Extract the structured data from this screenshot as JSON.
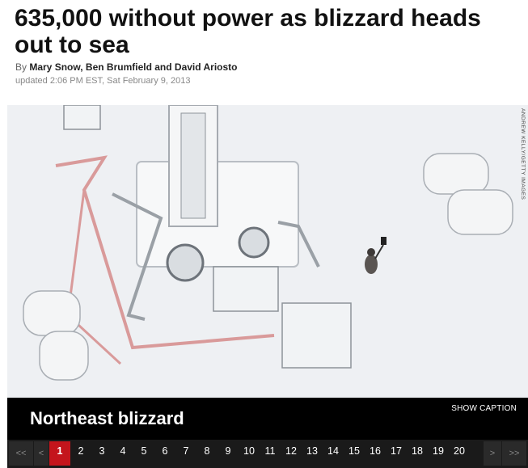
{
  "article": {
    "headline": "635,000 without power as blizzard heads out to sea",
    "byline_prefix": "By ",
    "authors": "Mary Snow, Ben Brumfield and David Ariosto",
    "updated": "updated 2:06 PM EST, Sat February 9, 2013"
  },
  "gallery": {
    "photo_credit": "ANDREW KELLY/GETTY IMAGES",
    "title": "Northeast blizzard",
    "show_caption_label": "SHOW CAPTION",
    "pager": {
      "first": "<<",
      "prev": "<",
      "next": ">",
      "last": ">>",
      "pages": [
        "1",
        "2",
        "3",
        "4",
        "5",
        "6",
        "7",
        "8",
        "9",
        "10",
        "11",
        "12",
        "13",
        "14",
        "15",
        "16",
        "17",
        "18",
        "19",
        "20"
      ],
      "active_page": "1"
    },
    "colors": {
      "active_page": "#c4151c",
      "bar": "#000000"
    }
  }
}
